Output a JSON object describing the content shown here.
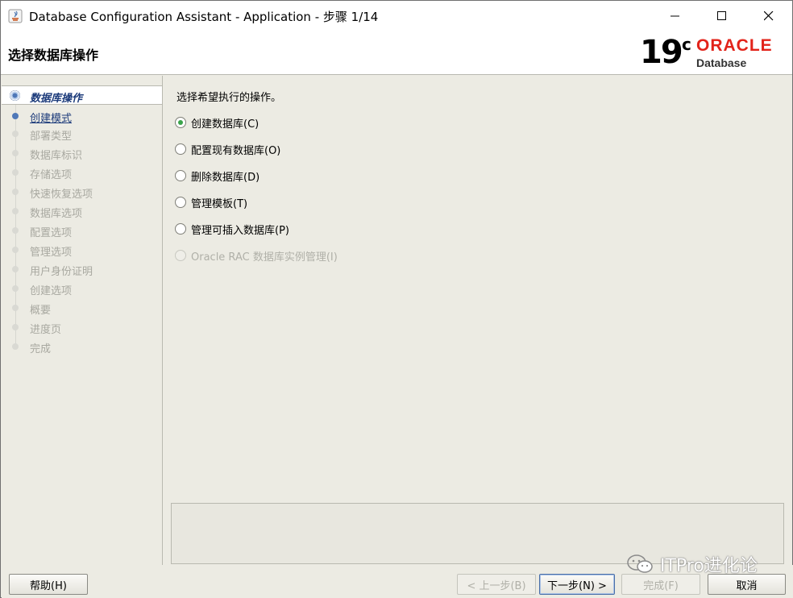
{
  "window": {
    "title": "Database Configuration Assistant - Application - 步骤 1/14"
  },
  "header": {
    "title": "选择数据库操作",
    "logo": {
      "version": "19",
      "version_sup": "c",
      "brand": "ORACLE",
      "product": "Database"
    }
  },
  "nav": {
    "items": [
      {
        "label": "数据库操作",
        "state": "current"
      },
      {
        "label": "创建模式",
        "state": "next"
      },
      {
        "label": "部署类型",
        "state": "disabled"
      },
      {
        "label": "数据库标识",
        "state": "disabled"
      },
      {
        "label": "存储选项",
        "state": "disabled"
      },
      {
        "label": "快速恢复选项",
        "state": "disabled"
      },
      {
        "label": "数据库选项",
        "state": "disabled"
      },
      {
        "label": "配置选项",
        "state": "disabled"
      },
      {
        "label": "管理选项",
        "state": "disabled"
      },
      {
        "label": "用户身份证明",
        "state": "disabled"
      },
      {
        "label": "创建选项",
        "state": "disabled"
      },
      {
        "label": "概要",
        "state": "disabled"
      },
      {
        "label": "进度页",
        "state": "disabled"
      },
      {
        "label": "完成",
        "state": "disabled"
      }
    ]
  },
  "main": {
    "prompt": "选择希望执行的操作。",
    "options": [
      {
        "label": "创建数据库(C)",
        "checked": true,
        "enabled": true
      },
      {
        "label": "配置现有数据库(O)",
        "checked": false,
        "enabled": true
      },
      {
        "label": "删除数据库(D)",
        "checked": false,
        "enabled": true
      },
      {
        "label": "管理模板(T)",
        "checked": false,
        "enabled": true
      },
      {
        "label": "管理可插入数据库(P)",
        "checked": false,
        "enabled": true
      },
      {
        "label": "Oracle RAC 数据库实例管理(I)",
        "checked": false,
        "enabled": false
      }
    ]
  },
  "footer": {
    "help": "帮助(H)",
    "back": "< 上一步(B)",
    "next": "下一步(N) >",
    "finish": "完成(F)",
    "cancel": "取消"
  },
  "watermark": {
    "text": "ITPro进化论"
  },
  "colors": {
    "background": "#ecebe3",
    "nav_active": "#1b3a7a",
    "oracle_red": "#e2231a",
    "radio_selected": "#3aa34a"
  }
}
